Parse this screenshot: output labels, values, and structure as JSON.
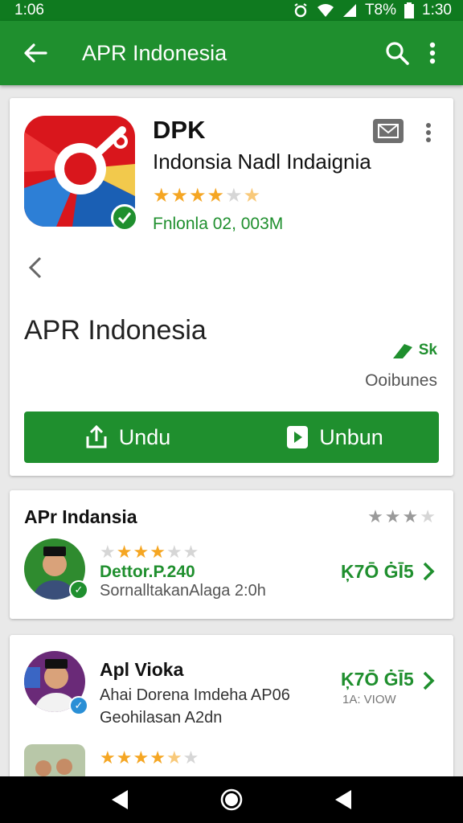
{
  "status_bar": {
    "time_left": "1:06",
    "battery": "T8%",
    "time_right": "1:30"
  },
  "app_bar": {
    "title": "APR Indonesia"
  },
  "app_card": {
    "name": "DPK",
    "developer": "Indonsia Nadl Indaignia",
    "rating_stars": [
      1,
      1,
      1,
      1,
      0.2,
      0.6
    ],
    "size_info": "Fnlonla 02, 003M",
    "big_title": "APR Indonesia",
    "side_badge": "Sk",
    "side_caption": "Ooibunes",
    "actions": {
      "left_label": "Undu",
      "right_label": "Unbun"
    }
  },
  "review_section": {
    "title": "APr Indansia",
    "summary_stars": [
      1,
      1,
      1,
      0.3
    ],
    "review": {
      "stars": [
        0.3,
        1,
        1,
        1,
        0.2,
        0.2
      ],
      "name": "Dettor.P.240",
      "meta": "SornalltakanAlaga 2:0h",
      "count": "Ķ7Ō ĠĪ5"
    }
  },
  "second_section": {
    "title": "Apl Vioka",
    "line1": "Ahai Dorena Imdeha AP06",
    "line2": "Geohilasan A2dn",
    "count": "Ķ7Ō ĠĪ5",
    "subcount": "1A: VIOW",
    "stars": [
      1,
      1,
      1,
      1,
      0.6,
      0.2
    ]
  },
  "colors": {
    "accent": "#1f8f2e",
    "status_bar": "#0f7a1f",
    "star": "#f5a623"
  }
}
